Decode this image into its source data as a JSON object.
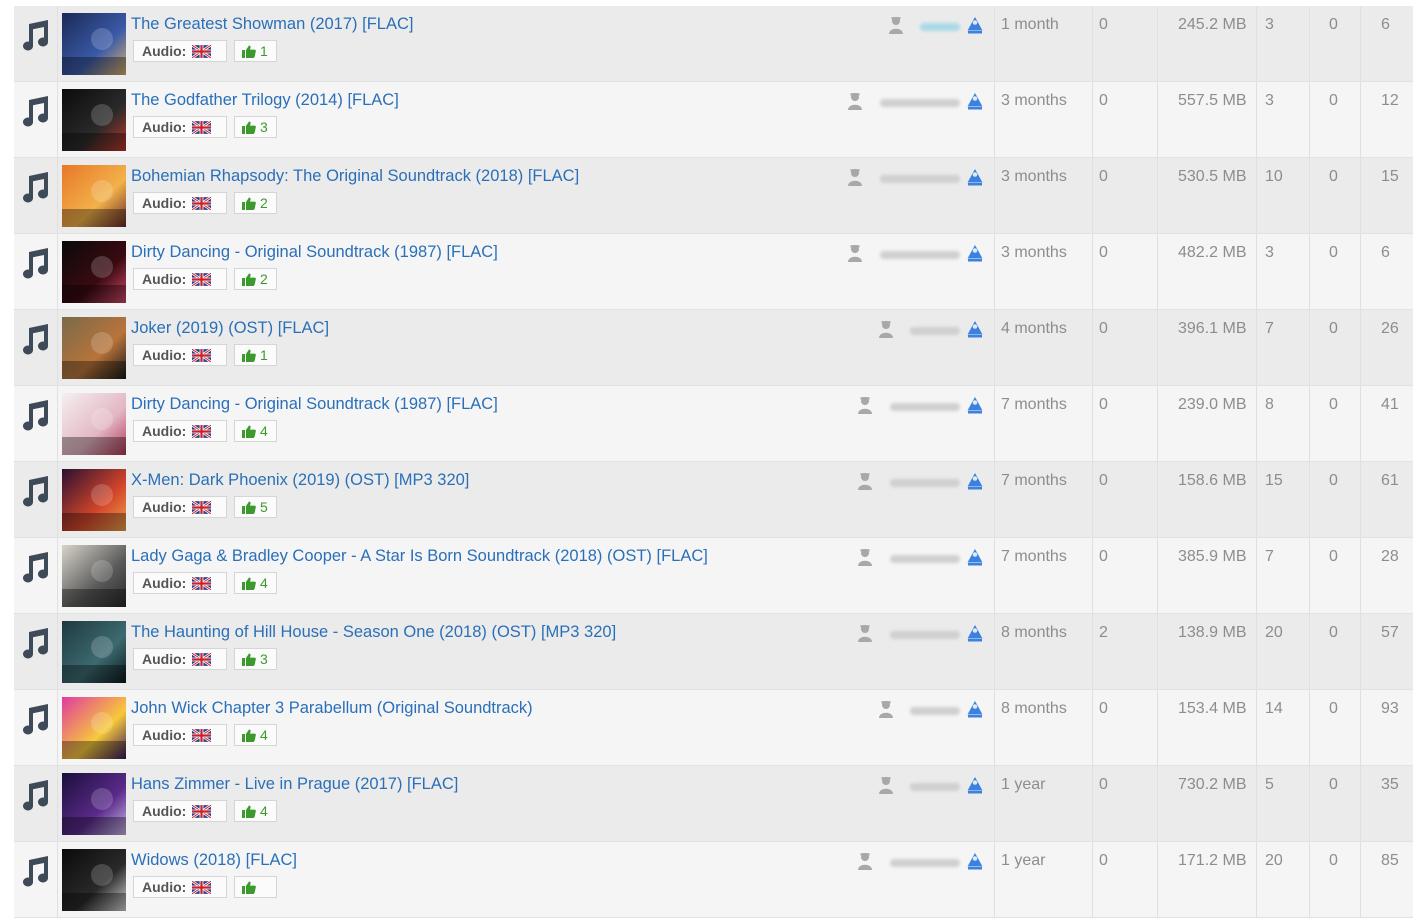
{
  "colors": {
    "title_link": "#2a6fb8",
    "thumbs": "#3c9a2c",
    "uploader_icon": "#3b82e0"
  },
  "torrents": [
    {
      "title": "The Greatest Showman (2017) [FLAC]",
      "audio_label": "Audio:",
      "likes": "1",
      "time": "1 month",
      "comments": "0",
      "size": "245.2 MB",
      "snatched": "3",
      "seeders": "0",
      "leechers": "6",
      "cover_colors": [
        "#1a2a55",
        "#3a5aa8",
        "#d9b36a"
      ]
    },
    {
      "title": "The Godfather Trilogy (2014) [FLAC]",
      "audio_label": "Audio:",
      "likes": "3",
      "time": "3 months",
      "comments": "0",
      "size": "557.5 MB",
      "snatched": "3",
      "seeders": "0",
      "leechers": "12",
      "cover_colors": [
        "#0b0b0b",
        "#2a2a2a",
        "#c0392b"
      ]
    },
    {
      "title": "Bohemian Rhapsody: The Original Soundtrack (2018) [FLAC]",
      "audio_label": "Audio:",
      "likes": "2",
      "time": "3 months",
      "comments": "0",
      "size": "530.5 MB",
      "snatched": "10",
      "seeders": "0",
      "leechers": "15",
      "cover_colors": [
        "#e8772a",
        "#f2b24a",
        "#6b2b2b"
      ]
    },
    {
      "title": "Dirty Dancing - Original Soundtrack (1987) [FLAC]",
      "audio_label": "Audio:",
      "likes": "2",
      "time": "3 months",
      "comments": "0",
      "size": "482.2 MB",
      "snatched": "3",
      "seeders": "0",
      "leechers": "6",
      "cover_colors": [
        "#0a0a0a",
        "#3a0a10",
        "#d14a6a"
      ]
    },
    {
      "title": "Joker (2019) (OST) [FLAC]",
      "audio_label": "Audio:",
      "likes": "1",
      "time": "4 months",
      "comments": "0",
      "size": "396.1 MB",
      "snatched": "7",
      "seeders": "0",
      "leechers": "26",
      "cover_colors": [
        "#7a6a4a",
        "#b8743a",
        "#1a1a1a"
      ]
    },
    {
      "title": "Dirty Dancing - Original Soundtrack (1987) [FLAC]",
      "audio_label": "Audio:",
      "likes": "4",
      "time": "7 months",
      "comments": "0",
      "size": "239.0 MB",
      "snatched": "8",
      "seeders": "0",
      "leechers": "41",
      "cover_colors": [
        "#f4efef",
        "#e3b7c4",
        "#b23a5a"
      ]
    },
    {
      "title": "X-Men: Dark Phoenix (2019) (OST) [MP3 320]",
      "audio_label": "Audio:",
      "likes": "5",
      "time": "7 months",
      "comments": "0",
      "size": "158.6 MB",
      "snatched": "15",
      "seeders": "0",
      "leechers": "61",
      "cover_colors": [
        "#2a1030",
        "#d2452a",
        "#f1a24a"
      ]
    },
    {
      "title": "Lady Gaga & Bradley Cooper - A Star Is Born Soundtrack (2018) (OST) [FLAC]",
      "audio_label": "Audio:",
      "likes": "4",
      "time": "7 months",
      "comments": "0",
      "size": "385.9 MB",
      "snatched": "7",
      "seeders": "0",
      "leechers": "28",
      "cover_colors": [
        "#d8d4c8",
        "#5a5a5a",
        "#2a2a2a"
      ]
    },
    {
      "title": "The Haunting of Hill House - Season One (2018) (OST) [MP3 320]",
      "audio_label": "Audio:",
      "likes": "3",
      "time": "8 months",
      "comments": "2",
      "size": "138.9 MB",
      "snatched": "20",
      "seeders": "0",
      "leechers": "57",
      "cover_colors": [
        "#1f3a40",
        "#3c6a70",
        "#0c1a1e"
      ]
    },
    {
      "title": "John Wick Chapter 3 Parabellum (Original Soundtrack)",
      "audio_label": "Audio:",
      "likes": "4",
      "time": "8 months",
      "comments": "0",
      "size": "153.4 MB",
      "snatched": "14",
      "seeders": "0",
      "leechers": "93",
      "cover_colors": [
        "#e13aa0",
        "#f7c93a",
        "#3a1a5a"
      ]
    },
    {
      "title": "Hans Zimmer - Live in Prague (2017) [FLAC]",
      "audio_label": "Audio:",
      "likes": "4",
      "time": "1 year",
      "comments": "0",
      "size": "730.2 MB",
      "snatched": "5",
      "seeders": "0",
      "leechers": "35",
      "cover_colors": [
        "#1a0f3a",
        "#5a2a8a",
        "#c9b7e8"
      ]
    },
    {
      "title": "Widows (2018) [FLAC]",
      "audio_label": "Audio:",
      "likes": "",
      "time": "1 year",
      "comments": "0",
      "size": "171.2 MB",
      "snatched": "20",
      "seeders": "0",
      "leechers": "85",
      "cover_colors": [
        "#0a0a0a",
        "#2a2a2a",
        "#d8d8d8"
      ]
    }
  ]
}
